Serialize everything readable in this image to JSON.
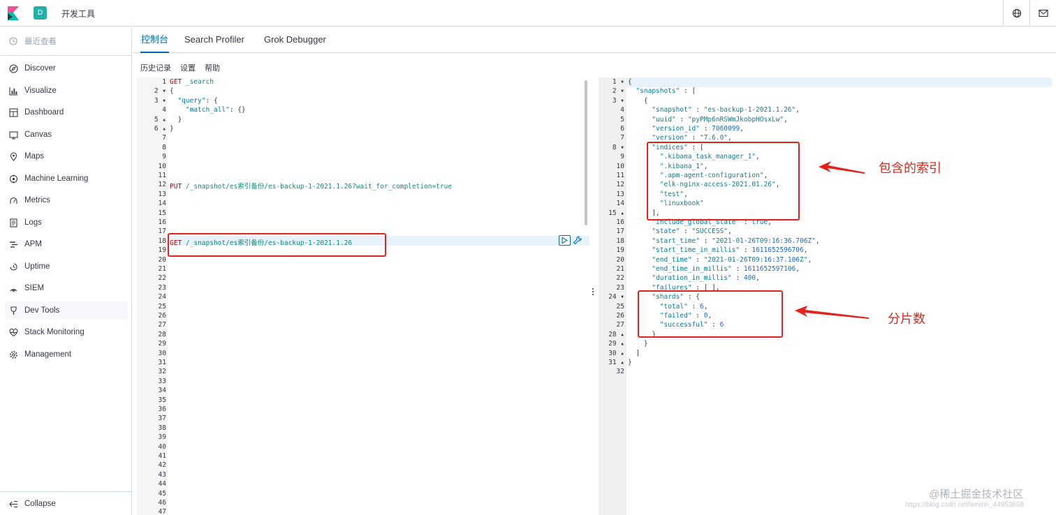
{
  "header": {
    "space_initial": "D",
    "app_title": "开发工具",
    "icons": [
      "kibana-logo-icon",
      "help-globe-icon",
      "mail-icon"
    ]
  },
  "sidebar": {
    "recent_label": "最近查看",
    "items": [
      {
        "label": "Discover",
        "icon": "compass-icon"
      },
      {
        "label": "Visualize",
        "icon": "visualize-icon"
      },
      {
        "label": "Dashboard",
        "icon": "dashboard-icon"
      },
      {
        "label": "Canvas",
        "icon": "canvas-icon"
      },
      {
        "label": "Maps",
        "icon": "maps-icon"
      },
      {
        "label": "Machine Learning",
        "icon": "machine-learning-icon"
      },
      {
        "label": "Metrics",
        "icon": "metrics-icon"
      },
      {
        "label": "Logs",
        "icon": "logs-icon"
      },
      {
        "label": "APM",
        "icon": "apm-icon"
      },
      {
        "label": "Uptime",
        "icon": "uptime-icon"
      },
      {
        "label": "SIEM",
        "icon": "siem-icon"
      },
      {
        "label": "Dev Tools",
        "icon": "dev-tools-icon"
      },
      {
        "label": "Stack Monitoring",
        "icon": "stack-monitoring-icon"
      },
      {
        "label": "Management",
        "icon": "gear-icon"
      }
    ],
    "collapse_label": "Collapse"
  },
  "tabs": [
    {
      "label": "控制台",
      "active": true
    },
    {
      "label": "Search Profiler",
      "active": false
    },
    {
      "label": "Grok Debugger",
      "active": false
    }
  ],
  "subnav": {
    "history": "历史记录",
    "settings": "设置",
    "help": "帮助"
  },
  "request_editor": {
    "line_count": 47,
    "lines": {
      "1": "GET _search",
      "2": "{",
      "3": "  \"query\": {",
      "4": "    \"match_all\": {}",
      "5": "  }",
      "6": "}",
      "12": "PUT /_snapshot/es索引备份/es-backup-1-2021.1.26?wait_for_completion=true",
      "18": "GET /_snapshot/es索引备份/es-backup-1-2021.1.26"
    }
  },
  "response_editor": {
    "line_count": 32,
    "lines": [
      "{",
      "  \"snapshots\" : [",
      "    {",
      "      \"snapshot\" : \"es-backup-1-2021.1.26\",",
      "      \"uuid\" : \"pyPMp6nRSWmJkobpHOsxLw\",",
      "      \"version_id\" : 7060099,",
      "      \"version\" : \"7.6.0\",",
      "      \"indices\" : [",
      "        \".kibana_task_manager_1\",",
      "        \".kibana_1\",",
      "        \".apm-agent-configuration\",",
      "        \"elk-nginx-access-2021.01.26\",",
      "        \"test\",",
      "        \"linuxbook\"",
      "      ],",
      "      \"include_global_state\" : true,",
      "      \"state\" : \"SUCCESS\",",
      "      \"start_time\" : \"2021-01-26T09:16:36.706Z\",",
      "      \"start_time_in_millis\" : 1611652596706,",
      "      \"end_time\" : \"2021-01-26T09:16:37.106Z\",",
      "      \"end_time_in_millis\" : 1611652597106,",
      "      \"duration_in_millis\" : 400,",
      "      \"failures\" : [ ],",
      "      \"shards\" : {",
      "        \"total\" : 6,",
      "        \"failed\" : 0,",
      "        \"successful\" : 6",
      "      }",
      "    }",
      "  ]",
      "}",
      ""
    ]
  },
  "annotations": {
    "indices_note": "包含的索引",
    "shards_note": "分片数"
  },
  "watermark": {
    "brand": "@稀土掘金技术社区",
    "url": "https://blog.csdn.net/weixin_44953658"
  },
  "colors": {
    "accent": "#006bb4",
    "annotation_red": "#e5211b",
    "space_badge": "#20b2aa"
  }
}
